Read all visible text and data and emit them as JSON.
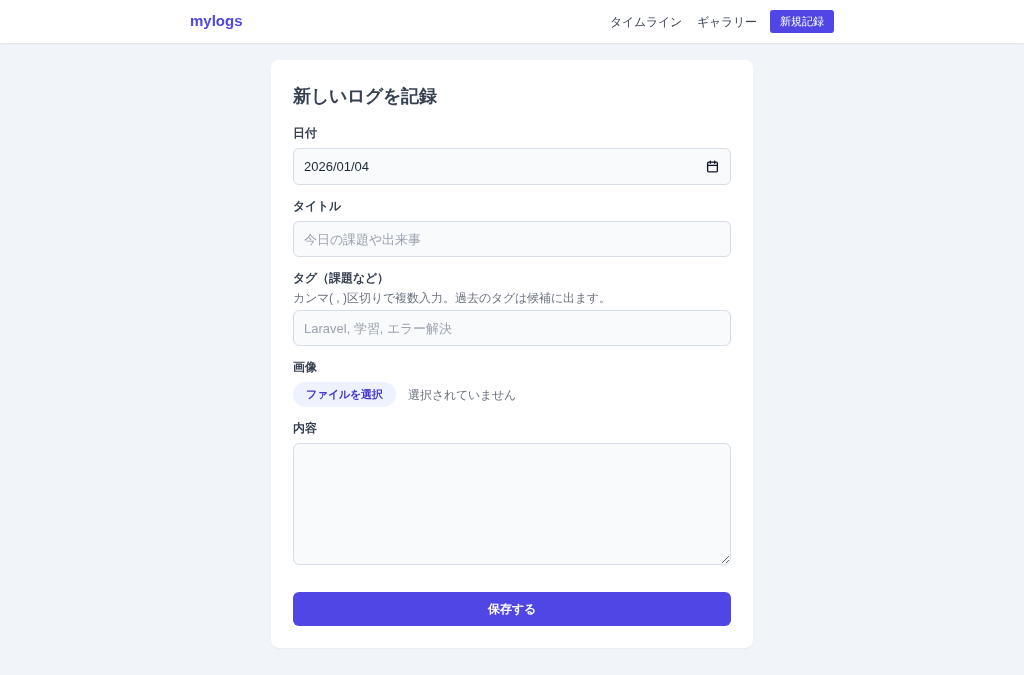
{
  "header": {
    "logo": "mylogs",
    "nav": [
      {
        "label": "タイムライン",
        "kind": "link"
      },
      {
        "label": "ギャラリー",
        "kind": "link"
      },
      {
        "label": "新規記録",
        "kind": "button"
      }
    ]
  },
  "form": {
    "title": "新しいログを記録",
    "fields": [
      {
        "kind": "date",
        "label": "日付",
        "value": "2026/01/04"
      },
      {
        "kind": "text",
        "label": "タイトル",
        "placeholder": "今日の課題や出来事"
      },
      {
        "kind": "text",
        "label": "タグ（課題など）",
        "hint": "カンマ( , )区切りで複数入力。過去のタグは候補に出ます。",
        "placeholder": "Laravel, 学習, エラー解決"
      },
      {
        "kind": "file",
        "label": "画像",
        "button": "ファイルを選択",
        "status": "選択されていません"
      },
      {
        "kind": "textarea",
        "label": "内容"
      }
    ],
    "submit": "保存する"
  }
}
